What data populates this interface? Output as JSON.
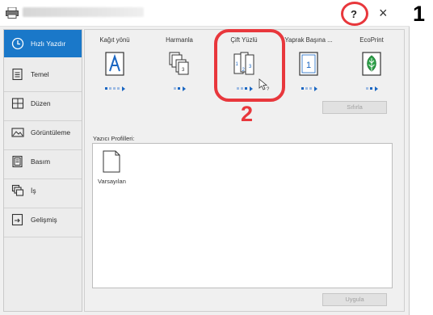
{
  "window": {
    "help_label": "?",
    "close_label": "×"
  },
  "callouts": {
    "first": "1",
    "second": "2"
  },
  "sidebar": {
    "items": [
      {
        "label": "Hızlı Yazdır",
        "icon": "clock-icon",
        "active": true
      },
      {
        "label": "Temel",
        "icon": "document-icon",
        "active": false
      },
      {
        "label": "Düzen",
        "icon": "layout-grid-icon",
        "active": false
      },
      {
        "label": "Görüntüleme",
        "icon": "image-icon",
        "active": false
      },
      {
        "label": "Basım",
        "icon": "print-document-icon",
        "active": false
      },
      {
        "label": "İş",
        "icon": "job-stack-icon",
        "active": false
      },
      {
        "label": "Gelişmiş",
        "icon": "advanced-icon",
        "active": false
      }
    ]
  },
  "quick_options": [
    {
      "label": "Kağıt yönü",
      "icon": "page-orientation-icon"
    },
    {
      "label": "Harmanla",
      "icon": "collate-icon"
    },
    {
      "label": "Çift Yüzlü",
      "icon": "duplex-icon"
    },
    {
      "label": "Yaprak Başına ...",
      "icon": "pages-per-sheet-icon"
    },
    {
      "label": "EcoPrint",
      "icon": "eco-leaf-icon"
    }
  ],
  "buttons": {
    "reset": "Sıfırla",
    "apply": "Uygula"
  },
  "profiles": {
    "label": "Yazıcı Profilleri:",
    "items": [
      {
        "name": "Varsayılan"
      }
    ]
  },
  "colors": {
    "accent": "#1a78c9",
    "highlight_ring": "#e8373c"
  }
}
